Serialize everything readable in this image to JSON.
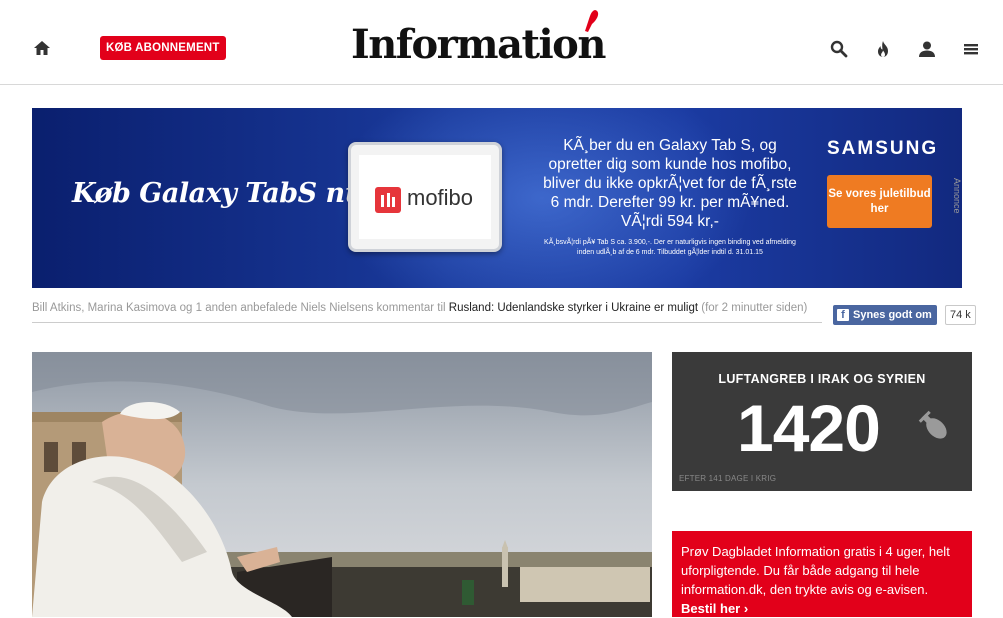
{
  "header": {
    "subscribe_label": "KØB ABONNEMENT",
    "logo_text": "Information",
    "icons": [
      "home-icon",
      "search-icon",
      "flame-icon",
      "user-icon",
      "menu-icon"
    ]
  },
  "ad": {
    "slogan": "Køb Galaxy TabS nu",
    "tablet_brand": "mofibo",
    "copy": "KÃ¸ber du en Galaxy Tab S, og opretter dig som kunde hos mofibo, bliver du ikke opkrÃ¦vet for de fÃ¸rste 6 mdr. Derefter 99 kr. per mÃ¥ned. VÃ¦rdi 594 kr,-",
    "fine_print": "KÃ¸bsvÃ¦rdi pÃ¥ Tab S ca. 3.900,-. Der er naturligvis ingen binding ved afmelding inden udlÃ¸b af de 6 mdr. Tilbuddet gÃ¦lder indtil d. 31.01.15",
    "brand": "SAMSUNG",
    "cta_label": "Se vores juletilbud her",
    "annonce_label": "Annonce",
    "colors": {
      "background": "#1a3a9c",
      "cta": "#ef7b22"
    }
  },
  "ticker": {
    "prefix": "Bill Atkins, Marina Kasimova og 1 anden anbefalede Niels Nielsens kommentar til ",
    "article": "Rusland: Udenlandske styrker i Ukraine er muligt",
    "suffix": " (for 2 minutter siden)"
  },
  "facebook": {
    "like_label": "Synes godt om",
    "count": "74 k"
  },
  "counter": {
    "title": "LUFTANGREB I IRAK OG SYRIEN",
    "value": "1420",
    "subtitle": "EFTER 141 DAGE I KRIG"
  },
  "promo": {
    "text": "Prøv Dagbladet Information gratis i 4 uger, helt uforpligtende. Du får både adgang til hele information.dk, den trykte avis og e-avisen.",
    "link_label": "Bestil her ›",
    "color": "#e2001a"
  }
}
